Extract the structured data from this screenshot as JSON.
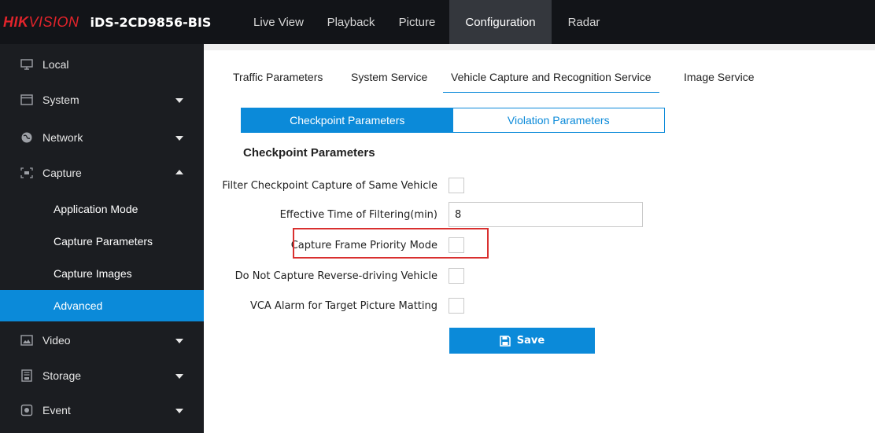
{
  "brand": {
    "logo_part1": "HIK",
    "logo_part2": "VISION",
    "model": "iDS-2CD9856-BIS"
  },
  "topnav": {
    "items": [
      {
        "label": "Live View"
      },
      {
        "label": "Playback"
      },
      {
        "label": "Picture"
      },
      {
        "label": "Configuration",
        "active": true
      },
      {
        "label": "Radar"
      }
    ]
  },
  "sidebar": {
    "items": [
      {
        "label": "Local",
        "icon": "monitor-icon"
      },
      {
        "label": "System",
        "icon": "window-icon"
      },
      {
        "label": "Network",
        "icon": "globe-icon"
      },
      {
        "label": "Capture",
        "icon": "capture-icon",
        "expanded": true
      },
      {
        "label": "Video",
        "icon": "image-icon"
      },
      {
        "label": "Storage",
        "icon": "storage-icon"
      },
      {
        "label": "Event",
        "icon": "event-icon"
      }
    ],
    "capture_sub": [
      {
        "label": "Application Mode"
      },
      {
        "label": "Capture Parameters"
      },
      {
        "label": "Capture Images"
      },
      {
        "label": "Advanced",
        "active": true
      }
    ]
  },
  "tabs": [
    {
      "label": "Traffic Parameters"
    },
    {
      "label": "System Service"
    },
    {
      "label": "Vehicle Capture and Recognition Service",
      "active": true
    },
    {
      "label": "Image Service"
    }
  ],
  "segmented": {
    "active": "Checkpoint Parameters",
    "inactive": "Violation Parameters"
  },
  "form": {
    "section_title": "Checkpoint Parameters",
    "filter_same_vehicle": {
      "label": "Filter Checkpoint Capture of Same Vehicle",
      "checked": false
    },
    "effective_time": {
      "label": "Effective Time of Filtering(min)",
      "value": "8"
    },
    "frame_priority": {
      "label": "Capture Frame Priority Mode",
      "checked": false
    },
    "reverse_driving": {
      "label": "Do Not Capture Reverse-driving Vehicle",
      "checked": false
    },
    "vca_alarm": {
      "label": "VCA Alarm for Target Picture Matting",
      "checked": false
    },
    "save_label": "Save"
  },
  "colors": {
    "accent": "#0b8ad9",
    "highlight_box": "#d9302f",
    "topbar": "#121418",
    "sidebar": "#1b1d21"
  }
}
